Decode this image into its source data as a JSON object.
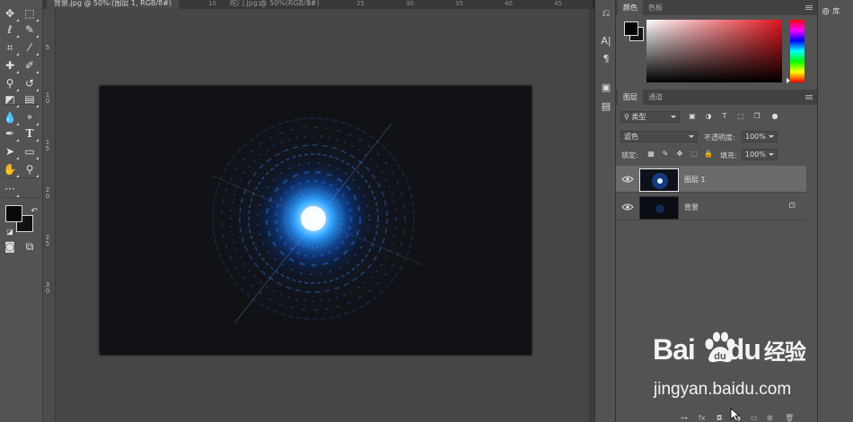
{
  "tabs": [
    {
      "label": "背景.jpg @ 50% (图层 1, RGB/8#)",
      "active": true
    },
    {
      "label": "陀门.jpg @ 50%(RGB/8#)",
      "active": false
    }
  ],
  "rulers": {
    "top_numbers": [
      "0",
      "5",
      "10",
      "15",
      "20",
      "25",
      "30",
      "35",
      "40",
      "45"
    ],
    "side_numbers": [
      "5",
      "1 0",
      "1 5",
      "2 0",
      "2 5",
      "3 0"
    ]
  },
  "tools": [
    {
      "name": "move-tool-icon",
      "glyph": "✥"
    },
    {
      "name": "marquee-tool-icon",
      "glyph": "⬚"
    },
    {
      "name": "lasso-tool-icon",
      "glyph": "ℓ"
    },
    {
      "name": "quick-select-tool-icon",
      "glyph": "✎"
    },
    {
      "name": "crop-tool-icon",
      "glyph": "⌗"
    },
    {
      "name": "eyedropper-tool-icon",
      "glyph": "⁄"
    },
    {
      "name": "healing-brush-icon",
      "glyph": "✚"
    },
    {
      "name": "brush-tool-icon",
      "glyph": "✐"
    },
    {
      "name": "clone-stamp-icon",
      "glyph": "⚲"
    },
    {
      "name": "history-brush-icon",
      "glyph": "↺"
    },
    {
      "name": "eraser-tool-icon",
      "glyph": "◩"
    },
    {
      "name": "gradient-tool-icon",
      "glyph": "▤"
    },
    {
      "name": "blur-tool-icon",
      "glyph": "💧"
    },
    {
      "name": "dodge-tool-icon",
      "glyph": "⚬"
    },
    {
      "name": "pen-tool-icon",
      "glyph": "✒"
    },
    {
      "name": "type-tool-icon",
      "glyph": "T"
    },
    {
      "name": "path-select-tool-icon",
      "glyph": "➤"
    },
    {
      "name": "rectangle-tool-icon",
      "glyph": "▭"
    },
    {
      "name": "hand-tool-icon",
      "glyph": "✋"
    },
    {
      "name": "zoom-tool-icon",
      "glyph": "⚲"
    },
    {
      "name": "edit-toolbar-icon",
      "glyph": "···"
    }
  ],
  "color_panel": {
    "tabs": [
      "颜色",
      "色板"
    ],
    "foreground": "#050505",
    "background": "#141414",
    "hue": "#e4141d"
  },
  "layers_panel": {
    "tabs": [
      "图层",
      "通道"
    ],
    "filter_kind": "类型",
    "blend_mode": "滤色",
    "opacity_label": "不透明度:",
    "opacity_value": "100%",
    "lock_label": "锁定:",
    "fill_label": "填充:",
    "fill_value": "100%",
    "layers": [
      {
        "name": "图层 1",
        "selected": true,
        "visible": true,
        "locked": false
      },
      {
        "name": "背景",
        "selected": false,
        "visible": true,
        "locked": true
      }
    ]
  },
  "right_icons": [
    "history-icon",
    "character-icon",
    "paragraph-icon",
    "properties-icon",
    "adjustments-icon"
  ],
  "libraries_label": "库",
  "watermark": {
    "brand_left": "Bai",
    "brand_right": "du",
    "brand_cn": "经验",
    "url": "jingyan.baidu.com"
  }
}
